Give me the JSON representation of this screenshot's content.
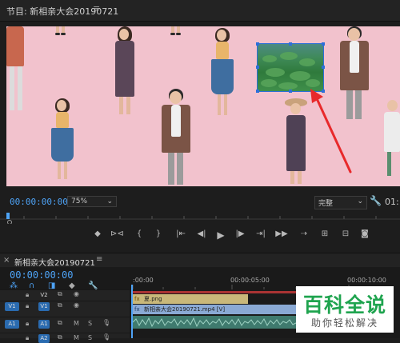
{
  "program": {
    "title": "节目: 新相亲大会20190721",
    "menu_glyph": "≡"
  },
  "controls": {
    "timecode_current": "00:00:00:00",
    "zoom": "75%",
    "quality": "完整",
    "timecode_end": "01:"
  },
  "timeline": {
    "sequence_tab": "新相亲大会20190721",
    "close_glyph": "×",
    "menu_glyph": "≡",
    "timecode": "00:00:00:00",
    "ruler_marks": [
      ":00:00",
      "00:00:05:00",
      "00:00:10:00"
    ],
    "tracks": {
      "v2_target": "V2",
      "v1_source": "V1",
      "v1_target": "V1",
      "a1_source": "A1",
      "a1_target": "A1",
      "a2_target": "A2"
    },
    "clips": {
      "png_clip": "夏.png",
      "video_clip": "新相亲大会20190721.mp4 [V]"
    }
  },
  "watermark": {
    "main": "百科全说",
    "sub": "助你轻松解决"
  },
  "colors": {
    "accent_blue": "#4ea3f6",
    "selection_blue": "#2d6fd8",
    "arrow_red": "#e8292b",
    "watermark_green": "#1fa44f",
    "background_pink": "#f2c2cd"
  }
}
